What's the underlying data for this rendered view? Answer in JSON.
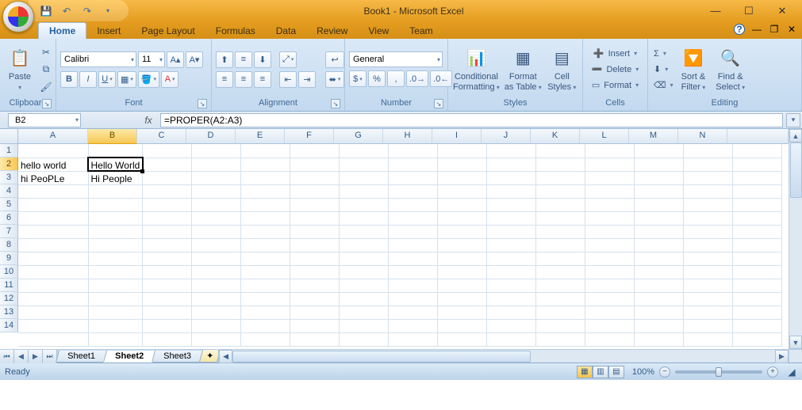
{
  "title": "Book1 - Microsoft Excel",
  "tabs": [
    "Home",
    "Insert",
    "Page Layout",
    "Formulas",
    "Data",
    "Review",
    "View",
    "Team"
  ],
  "active_tab": 0,
  "ribbon": {
    "clipboard": {
      "title": "Clipboard",
      "paste": "Paste"
    },
    "font": {
      "title": "Font",
      "family": "Calibri",
      "size": "11"
    },
    "alignment": {
      "title": "Alignment"
    },
    "number": {
      "title": "Number",
      "format": "General"
    },
    "styles": {
      "title": "Styles",
      "cond": "Conditional\nFormatting",
      "fmt_tbl": "Format\nas Table",
      "cell_sty": "Cell\nStyles"
    },
    "cells_g": {
      "title": "Cells",
      "insert": "Insert",
      "delete": "Delete",
      "format": "Format"
    },
    "editing": {
      "title": "Editing",
      "sort": "Sort &\nFilter",
      "find": "Find &\nSelect"
    }
  },
  "namebox": "B2",
  "formula": "=PROPER(A2:A3)",
  "columns": [
    "A",
    "B",
    "C",
    "D",
    "E",
    "F",
    "G",
    "H",
    "I",
    "J",
    "K",
    "L",
    "M",
    "N"
  ],
  "rows": [
    "1",
    "2",
    "3",
    "4",
    "5",
    "6",
    "7",
    "8",
    "9",
    "10",
    "11",
    "12",
    "13",
    "14"
  ],
  "cells": {
    "A2": "hello world",
    "B2": "Hello World",
    "A3": "hi PeoPLe",
    "B3": "Hi People"
  },
  "selected": "B2",
  "sheets": [
    "Sheet1",
    "Sheet2",
    "Sheet3"
  ],
  "active_sheet": 1,
  "status": "Ready",
  "zoom": "100%"
}
